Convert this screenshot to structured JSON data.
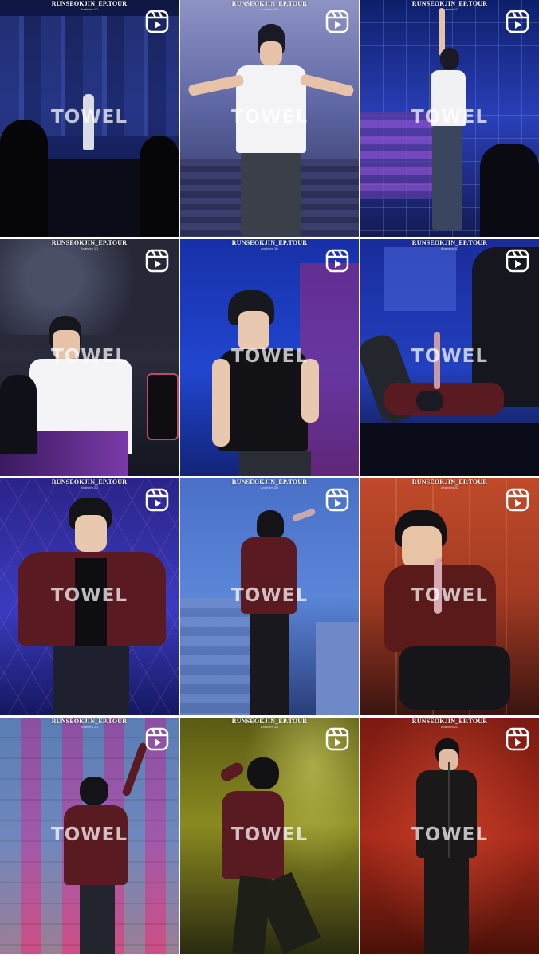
{
  "grid": {
    "tiles": [
      {
        "caption": "RUNSEOKJIN_EP.TOUR",
        "subcaption": "Anaheim 1D",
        "watermark": "TOWEL",
        "icon": "reels-icon"
      },
      {
        "caption": "RUNSEOKJIN_EP.TOUR",
        "subcaption": "Anaheim 1D",
        "watermark": "TOWEL",
        "icon": "reels-icon"
      },
      {
        "caption": "RUNSEOKJIN_EP.TOUR",
        "subcaption": "Anaheim 1D",
        "watermark": "TOWEL",
        "icon": "reels-icon"
      },
      {
        "caption": "RUNSEOKJIN_EP.TOUR",
        "subcaption": "Anaheim 1D",
        "watermark": "TOWEL",
        "icon": "reels-icon"
      },
      {
        "caption": "RUNSEOKJIN_EP.TOUR",
        "subcaption": "Anaheim 1D",
        "watermark": "TOWEL",
        "icon": "reels-icon"
      },
      {
        "caption": "RUNSEOKJIN_EP.TOUR",
        "subcaption": "Anaheim 1D",
        "watermark": "TOWEL",
        "icon": "reels-icon"
      },
      {
        "caption": "RUNSEOKJIN_EP.TOUR",
        "subcaption": "Anaheim 2D",
        "watermark": "TOWEL",
        "icon": "reels-icon"
      },
      {
        "caption": "RUNSEOKJIN_EP.TOUR",
        "subcaption": "Anaheim 2D",
        "watermark": "TOWEL",
        "icon": "reels-icon"
      },
      {
        "caption": "RUNSEOKJIN_EP.TOUR",
        "subcaption": "Anaheim 2D",
        "watermark": "TOWEL",
        "icon": "reels-icon"
      },
      {
        "caption": "RUNSEOKJIN_EP.TOUR",
        "subcaption": "Anaheim 2D",
        "watermark": "TOWEL",
        "icon": "reels-icon"
      },
      {
        "caption": "RUNSEOKJIN_EP.TOUR",
        "subcaption": "Anaheim 2D",
        "watermark": "TOWEL",
        "icon": "reels-icon"
      },
      {
        "caption": "RUNSEOKJIN_EP.TOUR",
        "subcaption": "Anaheim 2D",
        "watermark": "TOWEL",
        "icon": "reels-icon"
      }
    ]
  },
  "colors": {
    "stage_blue": "#1d2fa8",
    "stage_purple": "#3a1f8c",
    "stage_red": "#8a1e12",
    "stage_yellow": "#8a8a12",
    "jacket_maroon": "#5a1a22"
  }
}
